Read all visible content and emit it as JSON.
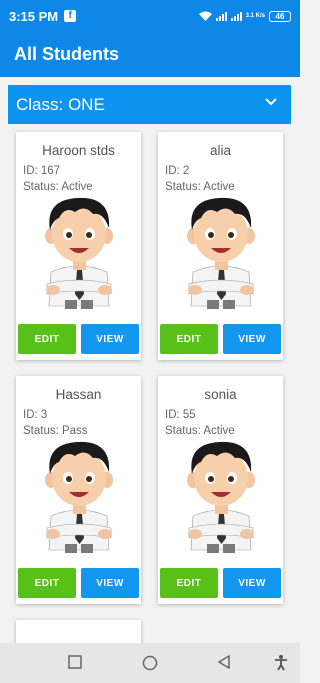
{
  "status_bar": {
    "time": "3:15 PM",
    "network": "3.1 K/s",
    "battery": "46"
  },
  "app_bar": {
    "title": "All Students"
  },
  "class_selector": {
    "label": "Class: ONE"
  },
  "students": [
    {
      "name": "Haroon stds",
      "id": "ID: 167",
      "status": "Status: Active",
      "edit": "EDIT",
      "view": "VIEW"
    },
    {
      "name": "alia",
      "id": "ID: 2",
      "status": "Status: Active",
      "edit": "EDIT",
      "view": "VIEW"
    },
    {
      "name": "Hassan",
      "id": "ID: 3",
      "status": "Status: Pass",
      "edit": "EDIT",
      "view": "VIEW"
    },
    {
      "name": "sonia",
      "id": "ID: 55",
      "status": "Status: Active",
      "edit": "EDIT",
      "view": "VIEW"
    }
  ],
  "colors": {
    "primary": "#0d88e8",
    "edit": "#57c11a",
    "view": "#1296ee"
  }
}
